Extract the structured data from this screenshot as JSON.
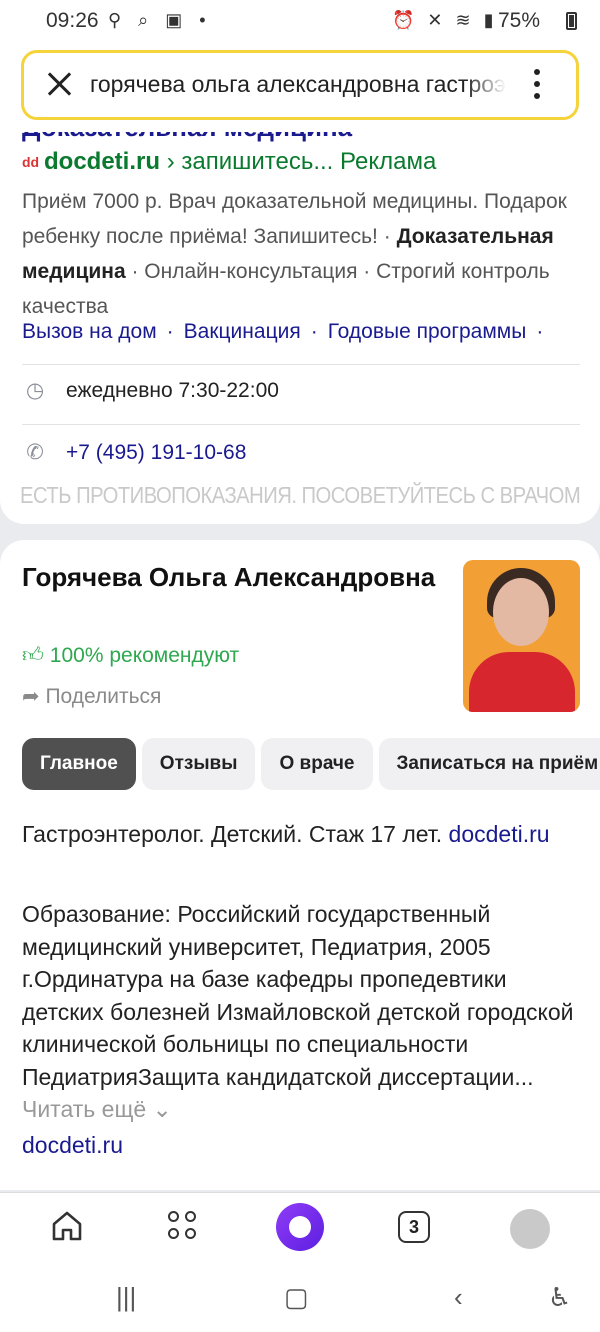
{
  "status": {
    "time": "09:26",
    "battery": "75%"
  },
  "search": {
    "query": "горячева ольга александровна гастроэнтеролог"
  },
  "ad": {
    "cut_title": "Доказательная медицина",
    "domain": "docdeti.ru",
    "path": "› запишитесь...",
    "label": "Реклама",
    "desc_part1": "Приём 7000 р. Врач доказательной медицины. Подарок ребенку после приёма! Запишитесь! · ",
    "desc_bold": "Доказательная медицина",
    "desc_part2": " · Онлайн-консультация · Строгий контроль качества",
    "links": [
      "Вызов на дом",
      "Вакцинация",
      "Годовые программы"
    ],
    "hours": "ежедневно 7:30-22:00",
    "phone": "+7 (495) 191-10-68",
    "warning": "ЕСТЬ ПРОТИВОПОКАЗАНИЯ. ПОСОВЕТУЙТЕСЬ С ВРАЧОМ"
  },
  "doctor": {
    "name": "Горячева Ольга Александровна",
    "recommend": "100% рекомендуют",
    "share": "Поделиться",
    "tabs": [
      "Главное",
      "Отзывы",
      "О враче",
      "Записаться на приём"
    ],
    "about": "Гастроэнтеролог. Детский. Стаж 17 лет.",
    "about_link": "docdeti.ru",
    "education": "Образование: Российский государственный медицинский университет, Педиатрия, 2005 г.Ординатура на базе кафедры пропедевтики детских болезней Измайловской детской городской клинической больницы по специальности ПедиатрияЗащита кандидатской диссертации...",
    "read_more": "Читать ещё",
    "site": "docdeti.ru"
  },
  "bottom_nav": {
    "tabs_count": "3"
  },
  "icons": {
    "close": "close-icon",
    "menu": "more-vertical-icon",
    "clock": "clock-icon",
    "phone": "phone-icon",
    "thumb": "thumbs-up-icon",
    "share": "share-icon",
    "home": "home-icon",
    "services": "grid-icon",
    "alice": "alice-icon",
    "tabs": "tabs-icon",
    "profile": "avatar-icon"
  }
}
